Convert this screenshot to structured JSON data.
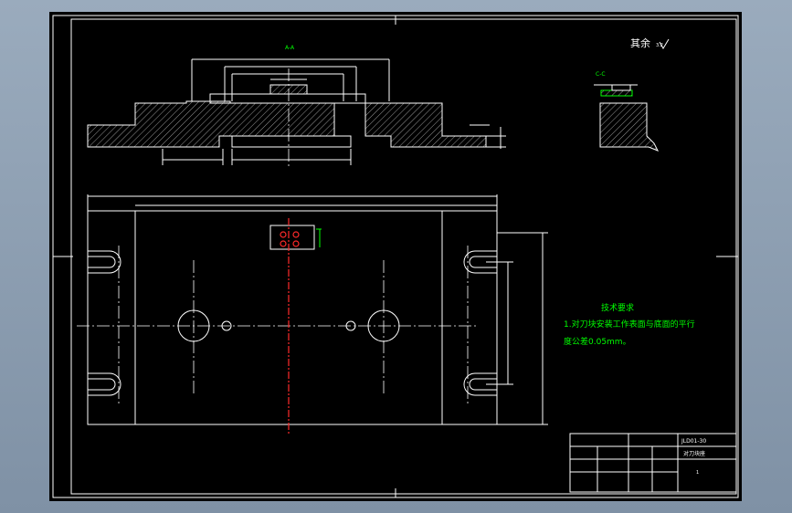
{
  "drawing": {
    "section_label": "A-A",
    "detail_label": "C-C",
    "roughness_note": "其余",
    "roughness_symbol": "3.2"
  },
  "tech_req": {
    "title": "技术要求",
    "line1": "1.对刀块安装工作表面与底面的平行",
    "line2": "度公差0.05mm。"
  },
  "title_block": {
    "drawing_no": "JLD01-30",
    "part_name": "对刀块座",
    "sheet": "1"
  },
  "colors": {
    "sheet": "#000000",
    "lines": "#ffffff",
    "text": "#00ff00",
    "center": "#ff2a2a"
  }
}
